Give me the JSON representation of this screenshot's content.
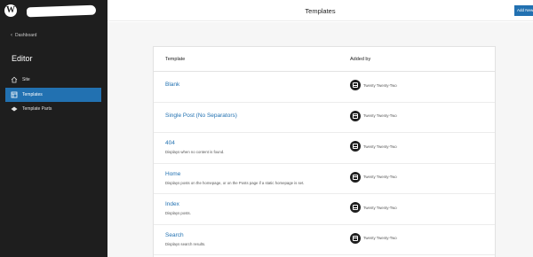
{
  "sidebar": {
    "back_label": "Dashboard",
    "section_title": "Editor",
    "items": [
      {
        "label": "Site",
        "icon": "home-icon"
      },
      {
        "label": "Templates",
        "icon": "template-icon",
        "active": true
      },
      {
        "label": "Template Parts",
        "icon": "template-parts-icon"
      }
    ]
  },
  "header": {
    "title": "Templates",
    "add_new_label": "Add New"
  },
  "table": {
    "columns": [
      "Template",
      "Added by"
    ],
    "rows": [
      {
        "name": "Blank",
        "description": "",
        "added_by": "Twenty Twenty-Two"
      },
      {
        "name": "Single Post (No Separators)",
        "description": "",
        "added_by": "Twenty Twenty-Two"
      },
      {
        "name": "404",
        "description": "Displays when no content is found.",
        "added_by": "Twenty Twenty-Two"
      },
      {
        "name": "Home",
        "description": "Displays posts on the homepage, or on the Posts page if a static homepage is set.",
        "added_by": "Twenty Twenty-Two"
      },
      {
        "name": "Index",
        "description": "Displays posts.",
        "added_by": "Twenty Twenty-Two"
      },
      {
        "name": "Search",
        "description": "Displays search results.",
        "added_by": "Twenty Twenty-Two"
      }
    ]
  },
  "colors": {
    "sidebar_bg": "#1e1e1e",
    "accent": "#2271b1",
    "canvas_bg": "#f6f6f6"
  }
}
